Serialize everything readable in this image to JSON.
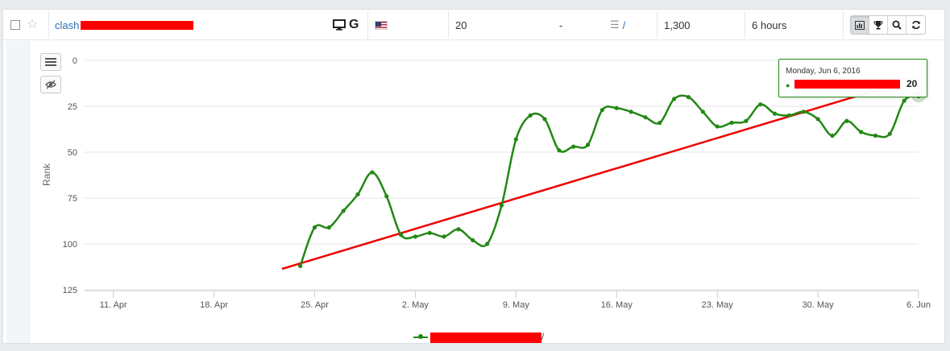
{
  "row": {
    "keyword_prefix": "clash",
    "rank": "20",
    "change": "-",
    "url_slash": "/",
    "search_volume": "1,300",
    "updated": "6 hours",
    "device_icon": "desktop-icon",
    "engine_icon": "google-icon",
    "country_icon": "us-flag-icon"
  },
  "toolbar_icons": [
    "bar-chart-icon",
    "trophy-icon",
    "search-icon",
    "refresh-icon"
  ],
  "tooltip": {
    "date": "Monday, Jun 6, 2016",
    "value": "20"
  },
  "legend": {
    "suffix": "/"
  },
  "colors": {
    "series": "#228814",
    "trend_arrow": "#ee0000",
    "redaction": "#ff0000",
    "link": "#2a70b8"
  },
  "chart_data": {
    "type": "line",
    "ylabel": "Rank",
    "y_reversed": true,
    "ylim": [
      0,
      125
    ],
    "y_ticks": [
      0,
      25,
      50,
      75,
      100,
      125
    ],
    "x_ticks": [
      "11. Apr",
      "18. Apr",
      "25. Apr",
      "2. May",
      "9. May",
      "16. May",
      "23. May",
      "30. May",
      "6. Jun"
    ],
    "x_range_days": [
      -2,
      56
    ],
    "series": [
      {
        "x_days": [
          13,
          14,
          15,
          16,
          17,
          18,
          19,
          20,
          21,
          22,
          23,
          24,
          25,
          26,
          27,
          28,
          29,
          30,
          31,
          32,
          33,
          34,
          35,
          36,
          37,
          38,
          39,
          40,
          41,
          42,
          43,
          44,
          45,
          46,
          47,
          48,
          49,
          50,
          51,
          52,
          53,
          54,
          55,
          56
        ],
        "values": [
          112,
          91,
          91,
          82,
          73,
          61,
          74,
          95,
          96,
          94,
          96,
          92,
          98,
          100,
          79,
          43,
          30,
          32,
          49,
          47,
          46,
          27,
          26,
          28,
          31,
          34,
          21,
          20,
          28,
          36,
          34,
          33,
          24,
          29,
          30,
          28,
          32,
          41,
          33,
          39,
          41,
          40,
          22,
          19
        ]
      }
    ]
  }
}
